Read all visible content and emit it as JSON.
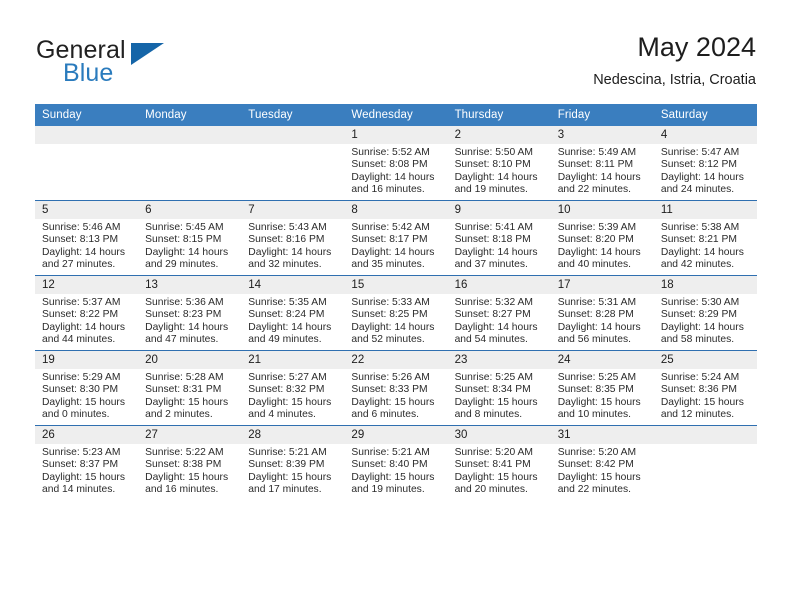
{
  "brand": {
    "word1": "General",
    "word2": "Blue",
    "triangle_color": "#1565a8",
    "blue_color": "#2a7bbd"
  },
  "header": {
    "title": "May 2024",
    "subtitle": "Nedescina, Istria, Croatia"
  },
  "theme": {
    "header_blue": "#3a7ebf",
    "row_rule_blue": "#2f6fb0",
    "daynum_band": "#eeeeee"
  },
  "weekday_headers": [
    "Sunday",
    "Monday",
    "Tuesday",
    "Wednesday",
    "Thursday",
    "Friday",
    "Saturday"
  ],
  "weeks": [
    [
      {
        "day": "",
        "blank": true,
        "sunrise": "",
        "sunset": "",
        "daylight": ""
      },
      {
        "day": "",
        "blank": true,
        "sunrise": "",
        "sunset": "",
        "daylight": ""
      },
      {
        "day": "",
        "blank": true,
        "sunrise": "",
        "sunset": "",
        "daylight": ""
      },
      {
        "day": "1",
        "blank": false,
        "sunrise": "Sunrise: 5:52 AM",
        "sunset": "Sunset: 8:08 PM",
        "daylight": "Daylight: 14 hours and 16 minutes."
      },
      {
        "day": "2",
        "blank": false,
        "sunrise": "Sunrise: 5:50 AM",
        "sunset": "Sunset: 8:10 PM",
        "daylight": "Daylight: 14 hours and 19 minutes."
      },
      {
        "day": "3",
        "blank": false,
        "sunrise": "Sunrise: 5:49 AM",
        "sunset": "Sunset: 8:11 PM",
        "daylight": "Daylight: 14 hours and 22 minutes."
      },
      {
        "day": "4",
        "blank": false,
        "sunrise": "Sunrise: 5:47 AM",
        "sunset": "Sunset: 8:12 PM",
        "daylight": "Daylight: 14 hours and 24 minutes."
      }
    ],
    [
      {
        "day": "5",
        "blank": false,
        "sunrise": "Sunrise: 5:46 AM",
        "sunset": "Sunset: 8:13 PM",
        "daylight": "Daylight: 14 hours and 27 minutes."
      },
      {
        "day": "6",
        "blank": false,
        "sunrise": "Sunrise: 5:45 AM",
        "sunset": "Sunset: 8:15 PM",
        "daylight": "Daylight: 14 hours and 29 minutes."
      },
      {
        "day": "7",
        "blank": false,
        "sunrise": "Sunrise: 5:43 AM",
        "sunset": "Sunset: 8:16 PM",
        "daylight": "Daylight: 14 hours and 32 minutes."
      },
      {
        "day": "8",
        "blank": false,
        "sunrise": "Sunrise: 5:42 AM",
        "sunset": "Sunset: 8:17 PM",
        "daylight": "Daylight: 14 hours and 35 minutes."
      },
      {
        "day": "9",
        "blank": false,
        "sunrise": "Sunrise: 5:41 AM",
        "sunset": "Sunset: 8:18 PM",
        "daylight": "Daylight: 14 hours and 37 minutes."
      },
      {
        "day": "10",
        "blank": false,
        "sunrise": "Sunrise: 5:39 AM",
        "sunset": "Sunset: 8:20 PM",
        "daylight": "Daylight: 14 hours and 40 minutes."
      },
      {
        "day": "11",
        "blank": false,
        "sunrise": "Sunrise: 5:38 AM",
        "sunset": "Sunset: 8:21 PM",
        "daylight": "Daylight: 14 hours and 42 minutes."
      }
    ],
    [
      {
        "day": "12",
        "blank": false,
        "sunrise": "Sunrise: 5:37 AM",
        "sunset": "Sunset: 8:22 PM",
        "daylight": "Daylight: 14 hours and 44 minutes."
      },
      {
        "day": "13",
        "blank": false,
        "sunrise": "Sunrise: 5:36 AM",
        "sunset": "Sunset: 8:23 PM",
        "daylight": "Daylight: 14 hours and 47 minutes."
      },
      {
        "day": "14",
        "blank": false,
        "sunrise": "Sunrise: 5:35 AM",
        "sunset": "Sunset: 8:24 PM",
        "daylight": "Daylight: 14 hours and 49 minutes."
      },
      {
        "day": "15",
        "blank": false,
        "sunrise": "Sunrise: 5:33 AM",
        "sunset": "Sunset: 8:25 PM",
        "daylight": "Daylight: 14 hours and 52 minutes."
      },
      {
        "day": "16",
        "blank": false,
        "sunrise": "Sunrise: 5:32 AM",
        "sunset": "Sunset: 8:27 PM",
        "daylight": "Daylight: 14 hours and 54 minutes."
      },
      {
        "day": "17",
        "blank": false,
        "sunrise": "Sunrise: 5:31 AM",
        "sunset": "Sunset: 8:28 PM",
        "daylight": "Daylight: 14 hours and 56 minutes."
      },
      {
        "day": "18",
        "blank": false,
        "sunrise": "Sunrise: 5:30 AM",
        "sunset": "Sunset: 8:29 PM",
        "daylight": "Daylight: 14 hours and 58 minutes."
      }
    ],
    [
      {
        "day": "19",
        "blank": false,
        "sunrise": "Sunrise: 5:29 AM",
        "sunset": "Sunset: 8:30 PM",
        "daylight": "Daylight: 15 hours and 0 minutes."
      },
      {
        "day": "20",
        "blank": false,
        "sunrise": "Sunrise: 5:28 AM",
        "sunset": "Sunset: 8:31 PM",
        "daylight": "Daylight: 15 hours and 2 minutes."
      },
      {
        "day": "21",
        "blank": false,
        "sunrise": "Sunrise: 5:27 AM",
        "sunset": "Sunset: 8:32 PM",
        "daylight": "Daylight: 15 hours and 4 minutes."
      },
      {
        "day": "22",
        "blank": false,
        "sunrise": "Sunrise: 5:26 AM",
        "sunset": "Sunset: 8:33 PM",
        "daylight": "Daylight: 15 hours and 6 minutes."
      },
      {
        "day": "23",
        "blank": false,
        "sunrise": "Sunrise: 5:25 AM",
        "sunset": "Sunset: 8:34 PM",
        "daylight": "Daylight: 15 hours and 8 minutes."
      },
      {
        "day": "24",
        "blank": false,
        "sunrise": "Sunrise: 5:25 AM",
        "sunset": "Sunset: 8:35 PM",
        "daylight": "Daylight: 15 hours and 10 minutes."
      },
      {
        "day": "25",
        "blank": false,
        "sunrise": "Sunrise: 5:24 AM",
        "sunset": "Sunset: 8:36 PM",
        "daylight": "Daylight: 15 hours and 12 minutes."
      }
    ],
    [
      {
        "day": "26",
        "blank": false,
        "sunrise": "Sunrise: 5:23 AM",
        "sunset": "Sunset: 8:37 PM",
        "daylight": "Daylight: 15 hours and 14 minutes."
      },
      {
        "day": "27",
        "blank": false,
        "sunrise": "Sunrise: 5:22 AM",
        "sunset": "Sunset: 8:38 PM",
        "daylight": "Daylight: 15 hours and 16 minutes."
      },
      {
        "day": "28",
        "blank": false,
        "sunrise": "Sunrise: 5:21 AM",
        "sunset": "Sunset: 8:39 PM",
        "daylight": "Daylight: 15 hours and 17 minutes."
      },
      {
        "day": "29",
        "blank": false,
        "sunrise": "Sunrise: 5:21 AM",
        "sunset": "Sunset: 8:40 PM",
        "daylight": "Daylight: 15 hours and 19 minutes."
      },
      {
        "day": "30",
        "blank": false,
        "sunrise": "Sunrise: 5:20 AM",
        "sunset": "Sunset: 8:41 PM",
        "daylight": "Daylight: 15 hours and 20 minutes."
      },
      {
        "day": "31",
        "blank": false,
        "sunrise": "Sunrise: 5:20 AM",
        "sunset": "Sunset: 8:42 PM",
        "daylight": "Daylight: 15 hours and 22 minutes."
      },
      {
        "day": "",
        "blank": true,
        "sunrise": "",
        "sunset": "",
        "daylight": ""
      }
    ]
  ]
}
